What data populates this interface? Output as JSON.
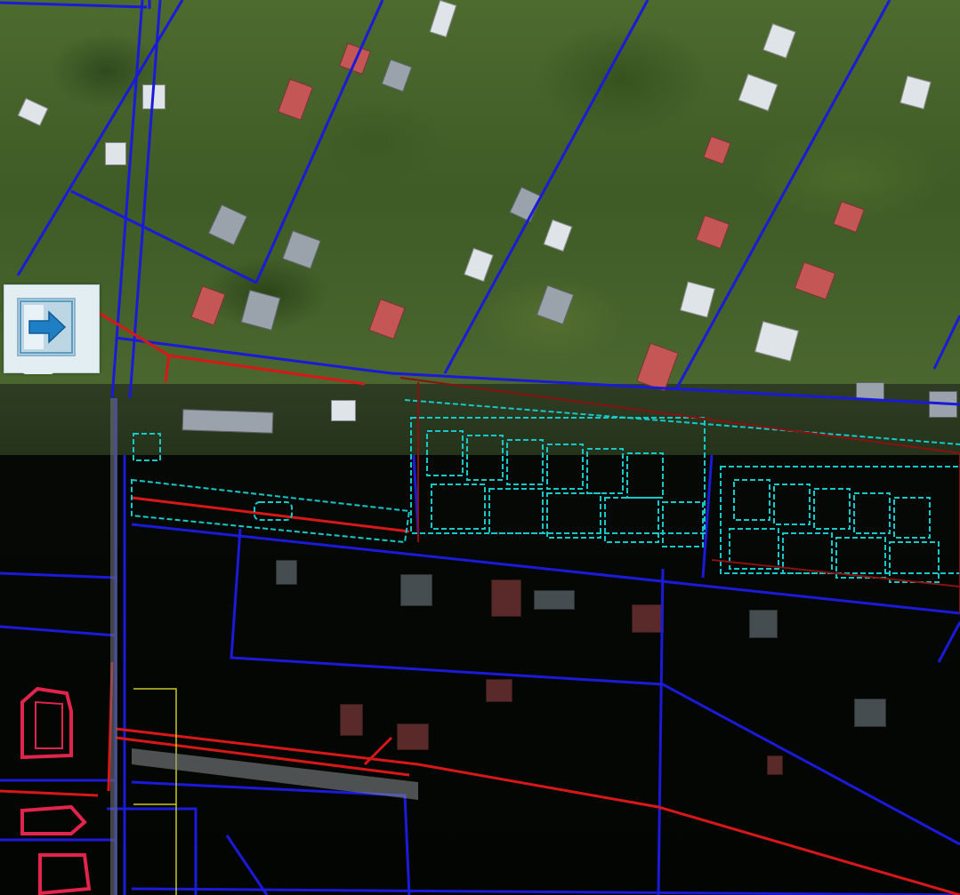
{
  "map": {
    "layers": {
      "aerial_daylight": "orthophoto",
      "aerial_dark": "orthophoto-dark",
      "parcel_boundaries": "blue",
      "utility_lines": "red",
      "building_outlines": "cyan",
      "road_edges": "yellow"
    },
    "colors": {
      "parcel_line": "#1a1ad8",
      "utility_line": "#d81818",
      "building_outline": "#15c9c9",
      "road_edge": "#c8c82a",
      "highlight_building": "#e0244c"
    }
  },
  "controls": {
    "pan_button": {
      "icon": "arrow-right-icon",
      "background": "#e3eef3",
      "accent": "#2f86c8"
    }
  }
}
